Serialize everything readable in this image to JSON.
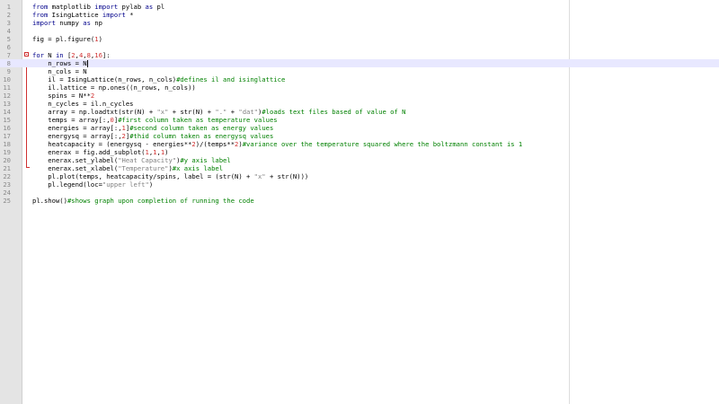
{
  "editor": {
    "current_line": 8,
    "lines": [
      {
        "n": "1",
        "tokens": [
          [
            "keyword",
            "from"
          ],
          [
            "plain",
            " matplotlib "
          ],
          [
            "keyword",
            "import"
          ],
          [
            "plain",
            " pylab "
          ],
          [
            "keyword",
            "as"
          ],
          [
            "plain",
            " pl"
          ]
        ]
      },
      {
        "n": "2",
        "tokens": [
          [
            "keyword",
            "from"
          ],
          [
            "plain",
            " IsingLattice "
          ],
          [
            "keyword",
            "import"
          ],
          [
            "plain",
            " *"
          ]
        ]
      },
      {
        "n": "3",
        "tokens": [
          [
            "keyword",
            "import"
          ],
          [
            "plain",
            " numpy "
          ],
          [
            "keyword",
            "as"
          ],
          [
            "plain",
            " np"
          ]
        ]
      },
      {
        "n": "4",
        "tokens": []
      },
      {
        "n": "5",
        "tokens": [
          [
            "plain",
            "fig = pl.figure("
          ],
          [
            "number",
            "1"
          ],
          [
            "plain",
            ")"
          ]
        ]
      },
      {
        "n": "6",
        "tokens": []
      },
      {
        "n": "7",
        "tokens": [
          [
            "keyword",
            "for"
          ],
          [
            "plain",
            " N "
          ],
          [
            "keyword",
            "in"
          ],
          [
            "plain",
            " ["
          ],
          [
            "number",
            "2"
          ],
          [
            "plain",
            ","
          ],
          [
            "number",
            "4"
          ],
          [
            "plain",
            ","
          ],
          [
            "number",
            "8"
          ],
          [
            "plain",
            ","
          ],
          [
            "number",
            "16"
          ],
          [
            "plain",
            "]:"
          ]
        ]
      },
      {
        "n": "8",
        "tokens": [
          [
            "plain",
            "    n_rows = N"
          ]
        ]
      },
      {
        "n": "9",
        "tokens": [
          [
            "plain",
            "    n_cols = N"
          ]
        ]
      },
      {
        "n": "10",
        "tokens": [
          [
            "plain",
            "    il = IsingLattice(n_rows, n_cols)"
          ],
          [
            "comment",
            "#defines il and isinglattice"
          ]
        ]
      },
      {
        "n": "11",
        "tokens": [
          [
            "plain",
            "    il.lattice = np.ones((n_rows, n_cols))"
          ]
        ]
      },
      {
        "n": "12",
        "tokens": [
          [
            "plain",
            "    spins = N**"
          ],
          [
            "number",
            "2"
          ]
        ]
      },
      {
        "n": "13",
        "tokens": [
          [
            "plain",
            "    n_cycles = il.n_cycles"
          ]
        ]
      },
      {
        "n": "14",
        "tokens": [
          [
            "plain",
            "    array = np.loadtxt(str(N) + "
          ],
          [
            "string",
            "\"x\""
          ],
          [
            "plain",
            " + str(N) + "
          ],
          [
            "string",
            "\".\""
          ],
          [
            "plain",
            " + "
          ],
          [
            "string",
            "\"dat\""
          ],
          [
            "plain",
            ")"
          ],
          [
            "comment",
            "#loads text files based of value of N"
          ]
        ]
      },
      {
        "n": "15",
        "tokens": [
          [
            "plain",
            "    temps = array[:,"
          ],
          [
            "number",
            "0"
          ],
          [
            "plain",
            "]"
          ],
          [
            "comment",
            "#first column taken as temperature values"
          ]
        ]
      },
      {
        "n": "16",
        "tokens": [
          [
            "plain",
            "    energies = array[:,"
          ],
          [
            "number",
            "1"
          ],
          [
            "plain",
            "]"
          ],
          [
            "comment",
            "#second column taken as energy values"
          ]
        ]
      },
      {
        "n": "17",
        "tokens": [
          [
            "plain",
            "    energysq = array[:,"
          ],
          [
            "number",
            "2"
          ],
          [
            "plain",
            "]"
          ],
          [
            "comment",
            "#thid column taken as energysq values"
          ]
        ]
      },
      {
        "n": "18",
        "tokens": [
          [
            "plain",
            "    heatcapacity = (energysq - energies**"
          ],
          [
            "number",
            "2"
          ],
          [
            "plain",
            ")/(temps**"
          ],
          [
            "number",
            "2"
          ],
          [
            "plain",
            ")"
          ],
          [
            "comment",
            "#variance over the temperature squared where the boltzmann constant is 1"
          ]
        ]
      },
      {
        "n": "19",
        "tokens": [
          [
            "plain",
            "    enerax = fig.add_subplot("
          ],
          [
            "number",
            "1"
          ],
          [
            "plain",
            ","
          ],
          [
            "number",
            "1"
          ],
          [
            "plain",
            ","
          ],
          [
            "number",
            "1"
          ],
          [
            "plain",
            ")"
          ]
        ]
      },
      {
        "n": "20",
        "tokens": [
          [
            "plain",
            "    enerax.set_ylabel("
          ],
          [
            "string",
            "\"Heat Capacity\""
          ],
          [
            "plain",
            ")"
          ],
          [
            "comment",
            "#y axis label"
          ]
        ]
      },
      {
        "n": "21",
        "tokens": [
          [
            "plain",
            "    enerax.set_xlabel("
          ],
          [
            "string",
            "\"Temperature\""
          ],
          [
            "plain",
            ")"
          ],
          [
            "comment",
            "#x axis label"
          ]
        ]
      },
      {
        "n": "22",
        "tokens": [
          [
            "plain",
            "    pl.plot(temps, heatcapacity/spins, label = (str(N) + "
          ],
          [
            "string",
            "\"x\""
          ],
          [
            "plain",
            " + str(N)))"
          ]
        ]
      },
      {
        "n": "23",
        "tokens": [
          [
            "plain",
            "    pl.legend(loc="
          ],
          [
            "string",
            "\"upper left\""
          ],
          [
            "plain",
            ")"
          ]
        ]
      },
      {
        "n": "24",
        "tokens": []
      },
      {
        "n": "25",
        "tokens": [
          [
            "plain",
            "pl.show()"
          ],
          [
            "comment",
            "#shows graph upon completion of running the code"
          ]
        ]
      }
    ]
  }
}
